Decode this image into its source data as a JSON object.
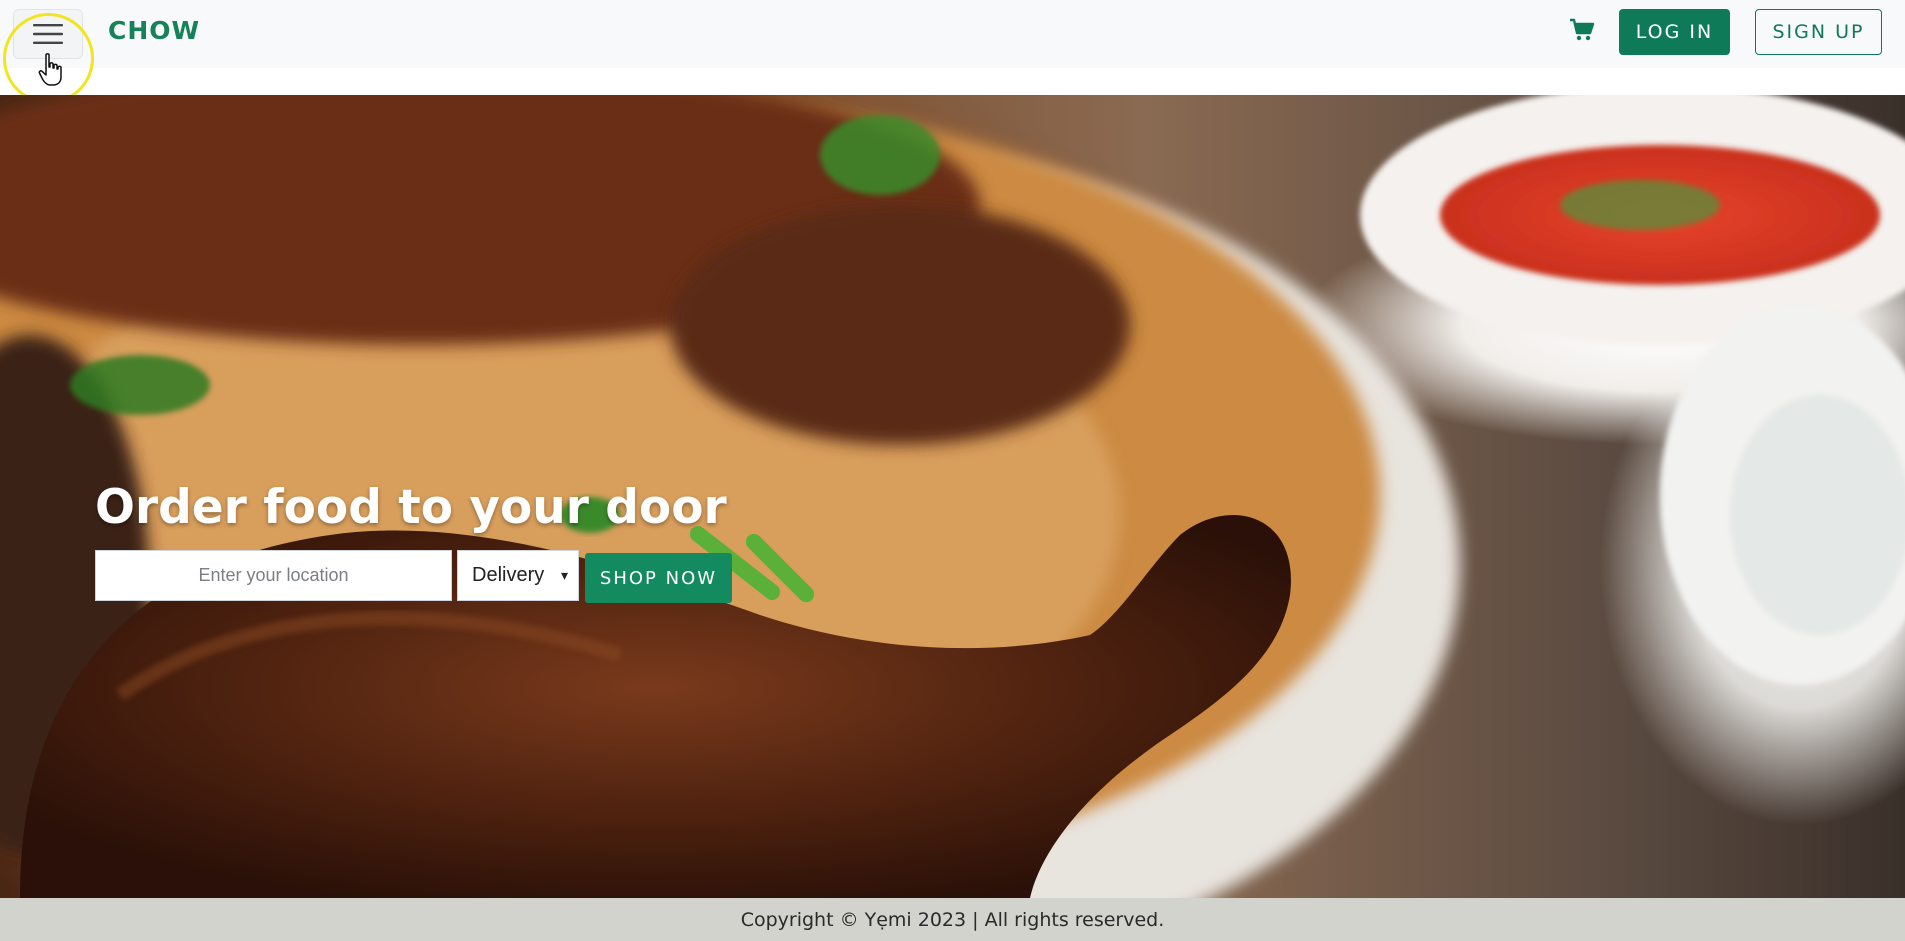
{
  "header": {
    "brand": "CHOW",
    "login_label": "LOG IN",
    "signup_label": "SIGN UP",
    "icons": {
      "menu": "hamburger-menu-icon",
      "cart": "shopping-cart-icon"
    }
  },
  "hero": {
    "title": "Order food to your door",
    "location_placeholder": "Enter your location",
    "location_value": "",
    "delivery_selected": "Delivery",
    "shop_label": "SHOP NOW"
  },
  "footer": {
    "copyright": "Copyright © Yẹmi 2023 | All rights reserved."
  },
  "colors": {
    "brand_green": "#0f7a57",
    "accent_green": "#138a5f",
    "footer_bg": "#d1d3cc",
    "header_bg": "#f8f9fa"
  }
}
